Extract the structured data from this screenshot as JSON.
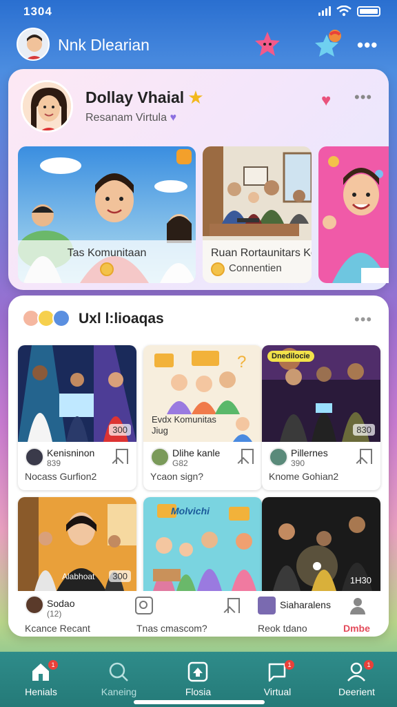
{
  "status": {
    "time": "1304"
  },
  "header": {
    "title": "Nnk Dlearian"
  },
  "profile": {
    "name": "Dollay Vhaial",
    "subtitle": "Resanam Virtula",
    "features": [
      {
        "title": "Tas Komunitaan",
        "meta": ""
      },
      {
        "title": "Ruan Rortaunitars Kdila Virtual",
        "meta": "Connentien"
      }
    ]
  },
  "groups": {
    "title": "Uxl l:lioaqas",
    "tiles": [
      {
        "name": "Kenisninon",
        "count": "839",
        "desc": "Nocass Gurfion2",
        "badge": "300",
        "overlay": ""
      },
      {
        "name": "Dlihe kanle",
        "count": "G82",
        "desc": "Ycaon sign?",
        "badge": "",
        "overlay": "Evdx Komunitas Jiug"
      },
      {
        "name": "Pillernes",
        "count": "390",
        "desc": "Knome Gohian2",
        "badge": "830",
        "overlay": "Dnedilocie"
      }
    ],
    "row2": [
      {
        "name": "Sodao",
        "count": "(12)",
        "desc": "Kcance Recant",
        "overlay": "Alabhoat",
        "badge": "300"
      },
      {
        "name": "",
        "count": "",
        "desc": "Tnas cmascom?",
        "overlay": "Molvichi",
        "badge": ""
      },
      {
        "name": "Siaharalens",
        "count": "",
        "desc": "Reok tdano",
        "overlay": "",
        "badge": "1H30",
        "action": "Dmbe"
      }
    ]
  },
  "tabs": [
    {
      "label": "Henials",
      "badge": "1"
    },
    {
      "label": "Kaneing",
      "badge": ""
    },
    {
      "label": "Flosia",
      "badge": ""
    },
    {
      "label": "Virtual",
      "badge": "1"
    },
    {
      "label": "Deerient",
      "badge": "1"
    }
  ]
}
